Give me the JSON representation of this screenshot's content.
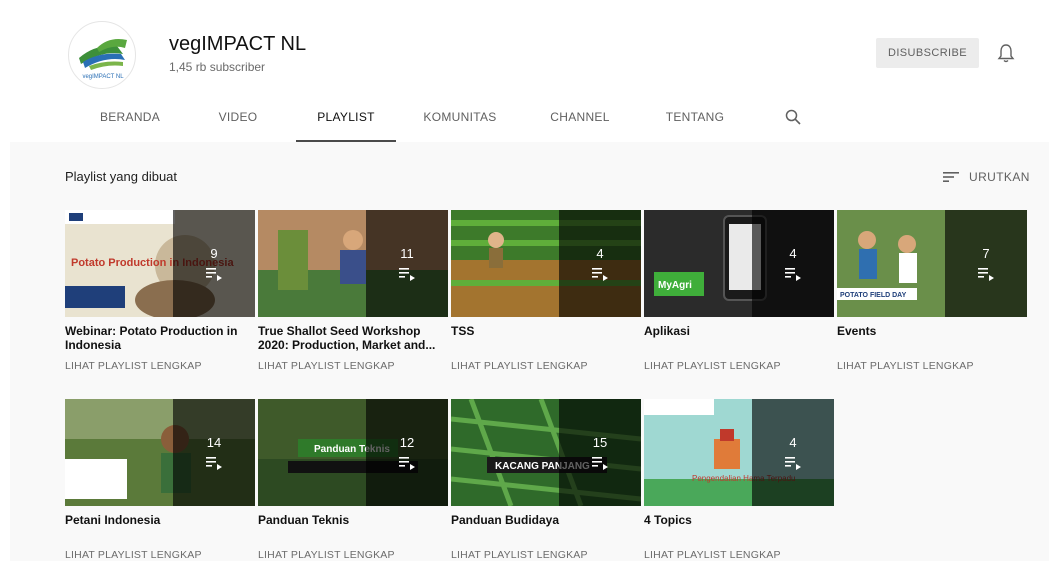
{
  "channel": {
    "name": "vegIMPACT NL",
    "subscribers": "1,45 rb subscriber",
    "logo_text": "vegIMPACT NL"
  },
  "header": {
    "unsubscribe_label": "DISUBSCRIBE",
    "bell_icon": "bell-icon"
  },
  "tabs": [
    {
      "label": "BERANDA"
    },
    {
      "label": "VIDEO"
    },
    {
      "label": "PLAYLIST",
      "active": true
    },
    {
      "label": "KOMUNITAS"
    },
    {
      "label": "CHANNEL"
    },
    {
      "label": "TENTANG"
    }
  ],
  "section": {
    "title": "Playlist yang dibuat",
    "sort_label": "URUTKAN",
    "sort_icon": "sort-icon"
  },
  "playlists": [
    {
      "title": "Webinar: Potato Production in Indonesia",
      "count": "9",
      "link": "LIHAT PLAYLIST LENGKAP",
      "thumb_text": "Potato Production in Indonesia"
    },
    {
      "title": "True Shallot Seed Workshop 2020: Production, Market and...",
      "count": "11",
      "link": "LIHAT PLAYLIST LENGKAP"
    },
    {
      "title": "TSS",
      "count": "4",
      "link": "LIHAT PLAYLIST LENGKAP"
    },
    {
      "title": "Aplikasi",
      "count": "4",
      "link": "LIHAT PLAYLIST LENGKAP",
      "thumb_text": "MyAgri"
    },
    {
      "title": "Events",
      "count": "7",
      "link": "LIHAT PLAYLIST LENGKAP",
      "thumb_text": "POTATO FIELD DAY"
    },
    {
      "title": "Petani Indonesia",
      "count": "14",
      "link": "LIHAT PLAYLIST LENGKAP"
    },
    {
      "title": "Panduan Teknis",
      "count": "12",
      "link": "LIHAT PLAYLIST LENGKAP",
      "thumb_text": "Panduan Teknis"
    },
    {
      "title": "Panduan Budidaya",
      "count": "15",
      "link": "LIHAT PLAYLIST LENGKAP",
      "thumb_text": "KACANG PANJANG"
    },
    {
      "title": "4 Topics",
      "count": "4",
      "link": "LIHAT PLAYLIST LENGKAP",
      "thumb_text": "Pengendalian Hama Terpadu"
    }
  ],
  "colors": {
    "overlay": "#000000",
    "page_bg": "#f9f9f9",
    "header_bg": "#ffffff"
  }
}
